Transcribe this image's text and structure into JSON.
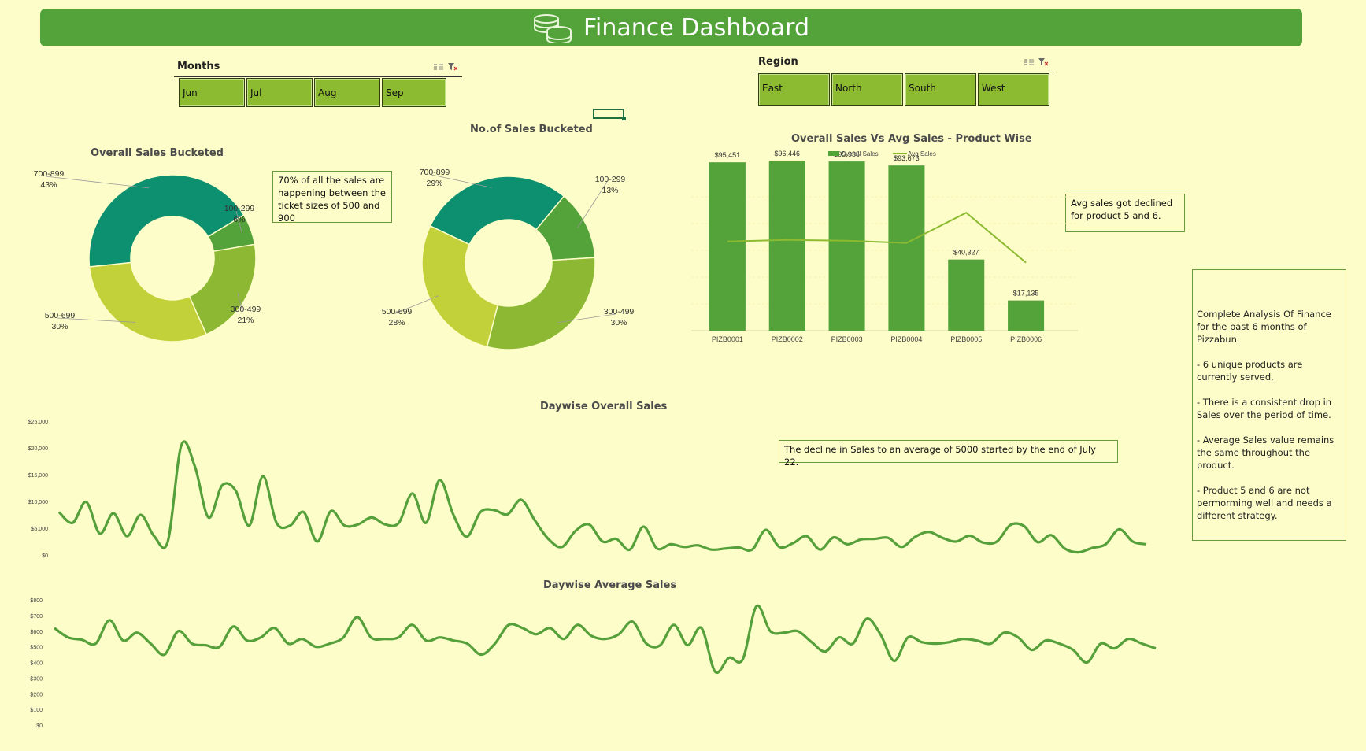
{
  "header": {
    "title": "Finance Dashboard",
    "icon": "coins-icon"
  },
  "slicers": {
    "months": {
      "title": "Months",
      "items": [
        "Jun",
        "Jul",
        "Aug",
        "Sep"
      ]
    },
    "region": {
      "title": "Region",
      "items": [
        "East",
        "North",
        "South",
        "West"
      ]
    }
  },
  "notes": {
    "buckets": "70% of all the sales are happening between the ticket sizes of 500 and 900",
    "avg_decline": "Avg sales got declined for product 5 and 6.",
    "daily_decline": "The decline in Sales to an average of 5000 started by the end of July 22.",
    "summary": [
      "Complete Analysis Of Finance for the past 6 months of Pizzabun.",
      "- 6 unique products are currently served.",
      "- There is a consistent drop in Sales over the period of time.",
      "- Average Sales value remains the same throughout the product.",
      "- Product 5 and 6 are not permorming well and needs a different strategy."
    ]
  },
  "colors": {
    "background": "#fdfdc9",
    "banner": "#53a23a",
    "teal": "#0d9070",
    "olive": "#53a23a",
    "mid_green": "#8cb833",
    "lime": "#c2d13a",
    "line": "#55a03a",
    "avg_line": "#8cba31"
  },
  "chart_data": [
    {
      "type": "pie",
      "title": "Overall Sales Bucketed",
      "categories": [
        "700-899",
        "100-299",
        "300-499",
        "500-699"
      ],
      "values": [
        43,
        6,
        21,
        30
      ],
      "labels": [
        "43%",
        "6%",
        "21%",
        "30%"
      ]
    },
    {
      "type": "pie",
      "title": "No.of Sales Bucketed",
      "categories": [
        "700-899",
        "100-299",
        "300-499",
        "500-699"
      ],
      "values": [
        29,
        13,
        30,
        28
      ],
      "labels": [
        "29%",
        "13%",
        "30%",
        "28%"
      ]
    },
    {
      "type": "bar",
      "title": "Overall Sales Vs Avg Sales - Product Wise",
      "categories": [
        "PIZB0001",
        "PIZB0002",
        "PIZB0003",
        "PIZB0004",
        "PIZB0005",
        "PIZB0006"
      ],
      "legend": [
        "Overall Sales",
        "Avg Sales"
      ],
      "series": [
        {
          "name": "Overall Sales",
          "values": [
            95451,
            96446,
            95936,
            93673,
            40327,
            17135
          ],
          "labels": [
            "$95,451",
            "$96,446",
            "$95,936",
            "$93,673",
            "$40,327",
            "$17,135"
          ]
        },
        {
          "name": "Avg Sales",
          "values": [
            590,
            600,
            595,
            580,
            780,
            450
          ]
        }
      ],
      "ylim": [
        0,
        120000
      ]
    },
    {
      "type": "line",
      "title": "Daywise Overall Sales",
      "yticks": [
        "$25,000",
        "$20,000",
        "$15,000",
        "$10,000",
        "$5,000",
        "$0"
      ],
      "ylim": [
        0,
        25000
      ],
      "values": [
        8000,
        6000,
        9900,
        4000,
        7800,
        3500,
        7500,
        3500,
        2500,
        20500,
        16500,
        7000,
        13000,
        12000,
        5500,
        14700,
        6000,
        5500,
        8000,
        2500,
        8200,
        5500,
        5700,
        7000,
        5700,
        6000,
        11500,
        6000,
        14000,
        7600,
        3400,
        8000,
        8400,
        7600,
        10300,
        6500,
        3000,
        1500,
        4500,
        5700,
        2500,
        3000,
        1000,
        5300,
        1200,
        2000,
        1500,
        1800,
        1000,
        1200,
        1400,
        1000,
        4700,
        1500,
        2200,
        3500,
        1000,
        3300,
        2000,
        2900,
        3000,
        3200,
        1500,
        3400,
        4300,
        3200,
        2500,
        3600,
        2300,
        2500,
        5600,
        5400,
        2400,
        3700,
        1200,
        500,
        1300,
        2000,
        4800,
        2500,
        2000
      ]
    },
    {
      "type": "line",
      "title": "Daywise  Average Sales",
      "yticks": [
        "$800",
        "$700",
        "$600",
        "$500",
        "$400",
        "$300",
        "$200",
        "$100",
        "$0"
      ],
      "ylim": [
        0,
        800
      ],
      "values": [
        620,
        560,
        545,
        520,
        670,
        540,
        590,
        520,
        450,
        600,
        520,
        510,
        500,
        630,
        540,
        560,
        620,
        520,
        550,
        500,
        520,
        560,
        690,
        560,
        550,
        560,
        640,
        540,
        560,
        540,
        520,
        450,
        520,
        640,
        620,
        580,
        620,
        550,
        640,
        570,
        550,
        580,
        660,
        520,
        510,
        640,
        510,
        620,
        340,
        430,
        420,
        760,
        600,
        590,
        600,
        530,
        470,
        560,
        520,
        680,
        580,
        410,
        560,
        530,
        520,
        530,
        550,
        540,
        520,
        590,
        560,
        480,
        540,
        520,
        480,
        400,
        520,
        490,
        550,
        520,
        490
      ]
    }
  ]
}
